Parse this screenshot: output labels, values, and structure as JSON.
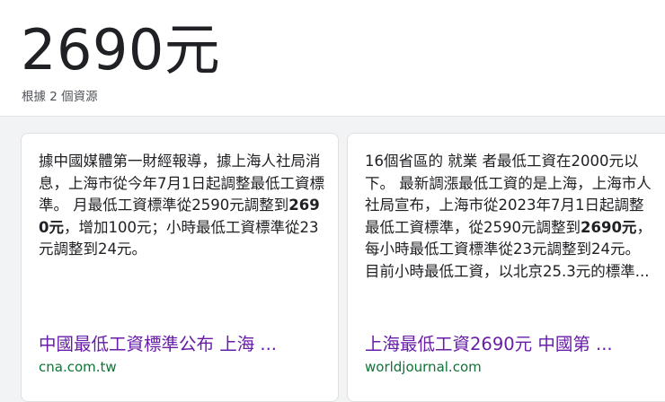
{
  "answer": {
    "value": "2690元",
    "source_count": "根據 2 個資源"
  },
  "sources": [
    {
      "snippet_before": "據中國媒體第一財經報導，據上海人社局消息，上海市從今年7月1日起調整最低工資標準。 月最低工資標準從2590元調整到",
      "snippet_bold": "2690元",
      "snippet_after": "，增加100元；小時最低工資標準從23元調整到24元。",
      "title": "中國最低工資標準公布 上海 ...",
      "domain": "cna.com.tw"
    },
    {
      "snippet_before": "16個省區的 就業 者最低工資在2000元以下。 最新調漲最低工資的是上海，上海市人社局宣布，上海市從2023年7月1日起調整最低工資標準，從2590元調整到",
      "snippet_bold": "2690元",
      "snippet_after": "，每小時最低工資標準從23元調整到24元。 目前小時最低工資，以北京25.3元的標準...",
      "title": "上海最低工資2690元 中國第 ...",
      "domain": "worldjournal.com"
    }
  ],
  "colors": {
    "title_link": "#681da8",
    "domain": "#0d7336",
    "background": "#f1f3f4"
  }
}
